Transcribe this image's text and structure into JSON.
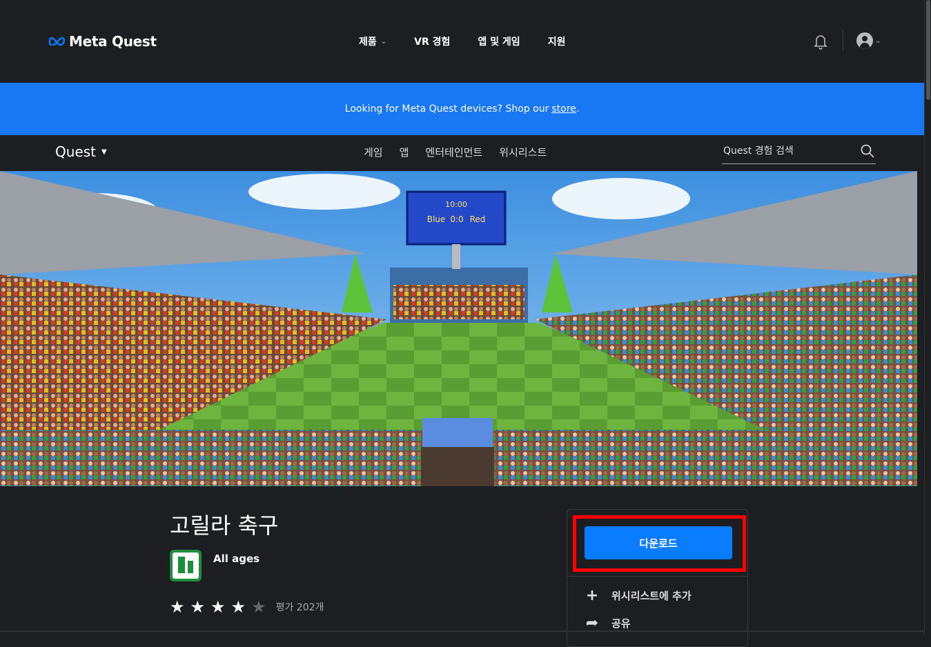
{
  "header": {
    "logo_text": "Meta Quest",
    "nav": [
      {
        "label": "제품",
        "has_dropdown": true
      },
      {
        "label": "VR 경험",
        "has_dropdown": false
      },
      {
        "label": "앱 및 게임",
        "has_dropdown": false
      },
      {
        "label": "지원",
        "has_dropdown": false
      }
    ],
    "icons": [
      "bell-icon",
      "account-icon"
    ]
  },
  "banner": {
    "text": "Looking for Meta Quest devices? Shop our",
    "link": "store",
    "suffix": ".",
    "color": "#1877f2"
  },
  "subnav": {
    "brand": "Quest",
    "links": [
      "게임",
      "앱",
      "엔터테인먼트",
      "위시리스트"
    ],
    "search_placeholder": "Quest 경험 검색"
  },
  "hero": {
    "scoreboard": {
      "time": "10:00",
      "home": "Blue",
      "score": "0:0",
      "away": "Red"
    }
  },
  "product": {
    "title": "고릴라 축구",
    "age_rating": "All ages",
    "stars": 4,
    "max_stars": 5,
    "reviews": "평가 202개"
  },
  "panel": {
    "download_label": "다운로드",
    "wishlist_label": "위시리스트에 추가",
    "share_label": "공유",
    "accent": "#0a7cff",
    "highlight_color": "#ff0000"
  }
}
